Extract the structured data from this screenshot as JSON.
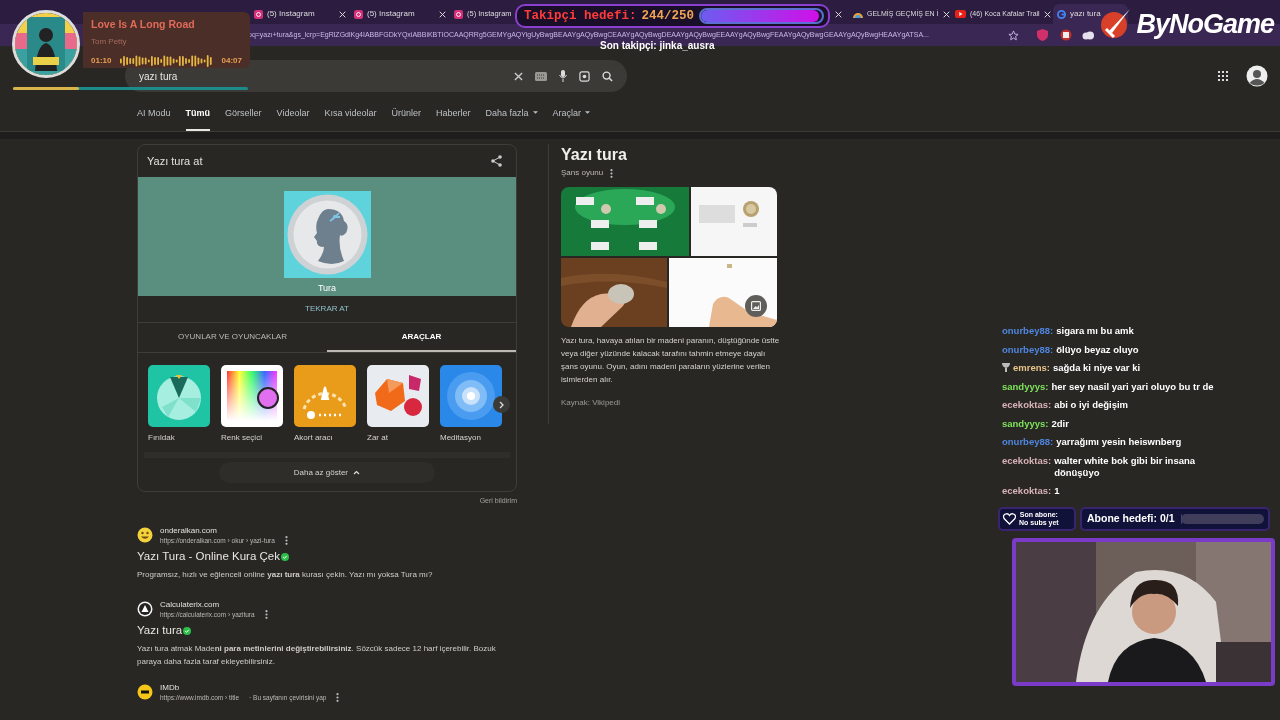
{
  "browser": {
    "tabs_left": [
      {
        "title": "(5) Instagram",
        "selected": false
      },
      {
        "title": "(5) Instagram",
        "selected": false
      },
      {
        "title": "(5) Instagram",
        "selected": false
      }
    ],
    "tabs_right": [
      {
        "title": "GELMİŞ GEÇMİŞ EN İ",
        "selected": false,
        "kind": "rainbow"
      },
      {
        "title": "(46) Koca Kafalar Trail",
        "selected": false,
        "kind": "youtube"
      },
      {
        "title": "yazı tura",
        "selected": true,
        "kind": "google"
      }
    ],
    "url": "oq=yazı+tura&gs_lcrp=EgRlZGdlKg4IABBFGDkYQxiABBiKBTIOCAAQRRg5GEMYgAQYigUyBwgBEAAYgAQyBwgCEAAYgAQyBwgDEAAYgAQyBwgEEAAYgAQyBwgFEAAYgAQyBwgGEAAYgAQyBwgHEAAYgATSA..."
  },
  "search": {
    "query": "yazı tura"
  },
  "nav": [
    {
      "label": "AI Modu",
      "selected": false,
      "menu": false
    },
    {
      "label": "Tümü",
      "selected": true,
      "menu": false
    },
    {
      "label": "Görseller",
      "selected": false,
      "menu": false
    },
    {
      "label": "Videolar",
      "selected": false,
      "menu": false
    },
    {
      "label": "Kısa videolar",
      "selected": false,
      "menu": false
    },
    {
      "label": "Ürünler",
      "selected": false,
      "menu": false
    },
    {
      "label": "Haberler",
      "selected": false,
      "menu": false
    },
    {
      "label": "Daha fazla",
      "selected": false,
      "menu": true
    },
    {
      "label": "Araçlar",
      "selected": false,
      "menu": true
    }
  ],
  "coin_card": {
    "title": "Yazı tura at",
    "result": "Tura",
    "button": "TEKRAR AT",
    "tabs": [
      {
        "label": "OYUNLAR VE OYUNCAKLAR",
        "selected": false
      },
      {
        "label": "ARAÇLAR",
        "selected": true
      }
    ],
    "tools": [
      {
        "label": "Fırıldak",
        "kind": "spinner"
      },
      {
        "label": "Renk seçici",
        "kind": "color"
      },
      {
        "label": "Akort aracı",
        "kind": "tuner"
      },
      {
        "label": "Zar at",
        "kind": "dice"
      },
      {
        "label": "Meditasyon",
        "kind": "meditation"
      }
    ],
    "toggle": "Daha az göster",
    "feedback": "Geri bildirim"
  },
  "knowledge_panel": {
    "title": "Yazı tura",
    "subtitle": "Şans oyunu",
    "description": "Yazı tura, havaya atılan bir madeni paranın, düştüğünde üstte veya diğer yüzünde kalacak tarafını tahmin etmeye dayalı şans oyunu. Oyun, adını madeni paraların yüzlerine verilen isimlerden alır.",
    "source_label": "Kaynak:",
    "source_link": "Vikipedi"
  },
  "results": [
    {
      "kind": "smiley",
      "site": "onderalkan.com",
      "url": "https://onderalkan.com › okur › yazi-tura",
      "title": "Yazı Tura - Online Kura Çek",
      "verified": true,
      "snippet": "Programsız, hızlı ve eğlenceli online **yazı tura** kurası çekin. Yazı mı yoksa Tura mı?"
    },
    {
      "kind": "arrow",
      "site": "Calculaterix.com",
      "url": "https://calculaterix.com › yazitura",
      "title": "Yazı tura",
      "verified": true,
      "snippet": "Yazı tura atmak Made**ni para metinlerini değiştirebilirsiniz**. Sözcük sadece 12 harf içerebilir. Bozuk paraya daha fazla taraf ekleyebilirsiniz."
    },
    {
      "kind": "imdb",
      "site": "IMDb",
      "url": "https://www.imdb.com › title",
      "translate": "· Bu sayfanın çevirisini yap"
    }
  ],
  "music": {
    "title": "Love Is A Long Road",
    "artist": "Tom Petty",
    "elapsed": "01:10",
    "duration": "04:07",
    "level": 0.28
  },
  "follower_goal": {
    "label": "Takipçi hedefi:",
    "count": "244/250",
    "level": 0.976,
    "latest": "Son takipçi: jinka_ausra"
  },
  "logo": {
    "text": "ByNoGame"
  },
  "chat": [
    {
      "user": "onurbey88:",
      "color": "#4f86e0",
      "badge": false,
      "text": "sigara mı bu amk"
    },
    {
      "user": "onurbey88:",
      "color": "#4f86e0",
      "badge": false,
      "text": "ölüyo beyaz oluyo"
    },
    {
      "user": "emrens:",
      "color": "#e8c48a",
      "badge": true,
      "text": "sağda ki niye var ki"
    },
    {
      "user": "sandyyys:",
      "color": "#7ee35a",
      "badge": false,
      "text": "her sey nasil yari yari oluyo bu tr de"
    },
    {
      "user": "ecekoktas:",
      "color": "#d9b3b8",
      "badge": false,
      "text": "abi o iyi değişim"
    },
    {
      "user": "sandyyys:",
      "color": "#7ee35a",
      "badge": false,
      "text": "2dir"
    },
    {
      "user": "onurbey88:",
      "color": "#4f86e0",
      "badge": false,
      "text": "yarrağımı yesin heiswnberg"
    },
    {
      "user": "ecekoktas:",
      "color": "#d9b3b8",
      "badge": false,
      "text": "walter white bok gibi bir insana dönüşüyo"
    },
    {
      "user": "ecekoktas:",
      "color": "#d9b3b8",
      "badge": false,
      "text": "1"
    }
  ],
  "subs": {
    "latest_label": "Son abone:",
    "latest": "No subs yet",
    "goal": "Abone hedefi: 0/1",
    "level": 0
  }
}
